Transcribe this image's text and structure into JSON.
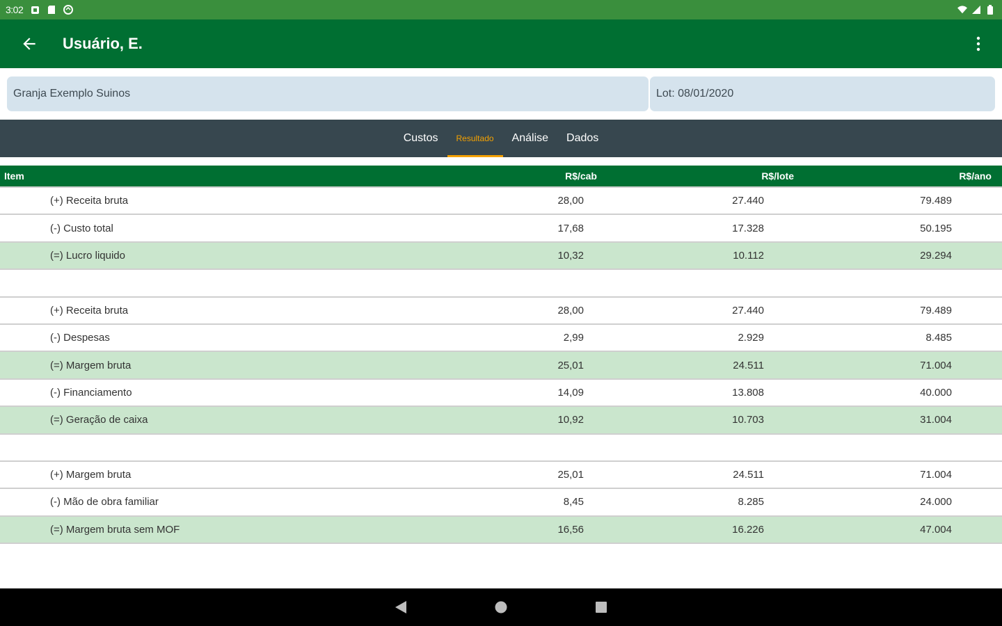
{
  "status_bar": {
    "time": "3:02",
    "icons_left": [
      "notification-icon",
      "sd-card-icon",
      "sync-icon"
    ],
    "icons_right": [
      "wifi-icon",
      "signal-icon",
      "battery-icon"
    ]
  },
  "app_bar": {
    "title": "Usuário, E.",
    "back_icon": "arrow-back-icon",
    "menu_icon": "more-vert-icon"
  },
  "info": {
    "farm": "Granja Exemplo Suinos",
    "lot": "Lot: 08/01/2020"
  },
  "tabs": [
    {
      "label": "Custos",
      "active": false
    },
    {
      "label": "Resultado",
      "active": true
    },
    {
      "label": "Análise",
      "active": false
    },
    {
      "label": "Dados",
      "active": false
    }
  ],
  "table": {
    "headers": {
      "item": "Item",
      "cab": "R$/cab",
      "lote": "R$/lote",
      "ano": "R$/ano"
    },
    "rows": [
      {
        "item": "(+) Receita bruta",
        "cab": "28,00",
        "lote": "27.440",
        "ano": "79.489",
        "type": "normal"
      },
      {
        "item": "(-) Custo total",
        "cab": "17,68",
        "lote": "17.328",
        "ano": "50.195",
        "type": "normal"
      },
      {
        "item": "(=) Lucro liquido",
        "cab": "10,32",
        "lote": "10.112",
        "ano": "29.294",
        "type": "result"
      },
      {
        "item": "",
        "cab": "",
        "lote": "",
        "ano": "",
        "type": "blank"
      },
      {
        "item": "(+) Receita bruta",
        "cab": "28,00",
        "lote": "27.440",
        "ano": "79.489",
        "type": "normal"
      },
      {
        "item": "(-) Despesas",
        "cab": "2,99",
        "lote": "2.929",
        "ano": "8.485",
        "type": "normal"
      },
      {
        "item": "(=) Margem bruta",
        "cab": "25,01",
        "lote": "24.511",
        "ano": "71.004",
        "type": "result"
      },
      {
        "item": "(-) Financiamento",
        "cab": "14,09",
        "lote": "13.808",
        "ano": "40.000",
        "type": "normal"
      },
      {
        "item": "(=) Geração de caixa",
        "cab": "10,92",
        "lote": "10.703",
        "ano": "31.004",
        "type": "result"
      },
      {
        "item": "",
        "cab": "",
        "lote": "",
        "ano": "",
        "type": "blank"
      },
      {
        "item": "(+) Margem bruta",
        "cab": "25,01",
        "lote": "24.511",
        "ano": "71.004",
        "type": "normal"
      },
      {
        "item": "(-) Mão de obra familiar",
        "cab": "8,45",
        "lote": "8.285",
        "ano": "24.000",
        "type": "normal"
      },
      {
        "item": "(=) Margem bruta sem MOF",
        "cab": "16,56",
        "lote": "16.226",
        "ano": "47.004",
        "type": "result"
      }
    ]
  },
  "nav_bar": {
    "buttons": [
      "back-triangle-icon",
      "home-circle-icon",
      "recents-square-icon"
    ]
  },
  "colors": {
    "status_bar": "#3a8f3d",
    "app_bar": "#006f32",
    "tab_bar": "#37474f",
    "tab_active": "#f4a100",
    "result_row": "#cae6cd",
    "info_box": "#d5e3ed"
  }
}
